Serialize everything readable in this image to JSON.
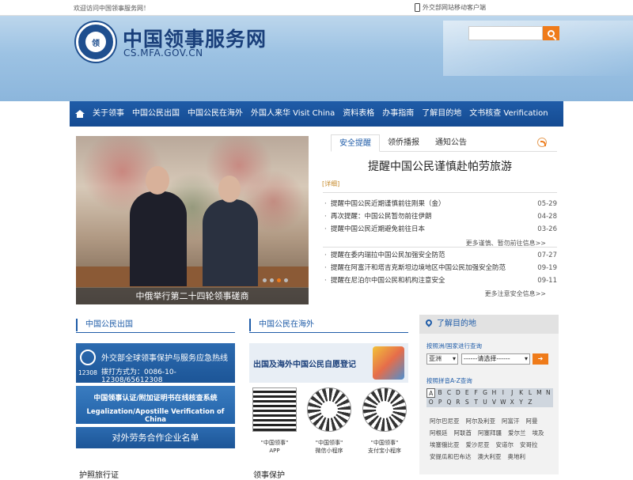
{
  "topbar": {
    "welcome": "欢迎访问中国领事服务网！",
    "mobile": "外交部网站移动客户端"
  },
  "site": {
    "title": "中国领事服务网",
    "domain": "CS.MFA.GOV.CN",
    "emblem_text": "领"
  },
  "nav": {
    "items": [
      "关于领事",
      "中国公民出国",
      "中国公民在海外",
      "外国人来华 Visit China",
      "资料表格",
      "办事指南",
      "了解目的地",
      "文书核查 Verification"
    ]
  },
  "hero": {
    "caption": "中俄举行第二十四轮领事磋商"
  },
  "tabs": {
    "items": [
      "安全提醒",
      "领侨播报",
      "通知公告"
    ],
    "active": 0
  },
  "headline": {
    "title": "提醒中国公民谨慎赴帕劳旅游",
    "detail": "[详细]"
  },
  "news1": [
    {
      "title": "提醒中国公民近期谨慎前往刚果（金）",
      "date": "05-29"
    },
    {
      "title": "再次提醒：中国公民暂勿前往伊朗",
      "date": "04-28"
    },
    {
      "title": "提醒中国公民近期避免前往日本",
      "date": "03-26"
    }
  ],
  "more1": "更多谨慎、暂勿前往信息>>",
  "news2": [
    {
      "title": "提醒在委内瑞拉中国公民加强安全防范",
      "date": "07-27"
    },
    {
      "title": "提醒在阿富汗和塔吉克斯坦边境地区中国公民加强安全防范",
      "date": "09-19"
    },
    {
      "title": "提醒在尼泊尔中国公民和机构注意安全",
      "date": "09-11"
    }
  ],
  "more2": "更多注意安全信息>>",
  "sections": {
    "outbound": "中国公民出国",
    "overseas": "中国公民在海外"
  },
  "hotline": {
    "title": "外交部全球领事保护与服务应急热线",
    "numbers": "拨打方式为：0086-10-12308/65612308",
    "badge": "12308"
  },
  "verify": {
    "cn": "中国领事认证/附加证明书在线核查系统",
    "en": "Legalization/Apostille Verification of China"
  },
  "labor": "对外劳务合作企业名单",
  "selfreg": "出国及海外中国公民自愿登记",
  "qrs": [
    {
      "label1": "\"中国领事\"",
      "label2": "APP"
    },
    {
      "label1": "\"中国领事\"",
      "label2": "微信小程序"
    },
    {
      "label1": "\"中国领事\"",
      "label2": "支付宝小程序"
    }
  ],
  "dest": {
    "title": "了解目的地",
    "by_continent": "按照洲/国家进行查询",
    "continent": "亚洲",
    "country": "------请选择------",
    "by_letter": "按照拼音A-Z查询",
    "letters": [
      "A",
      "B",
      "C",
      "D",
      "E",
      "F",
      "G",
      "H",
      "I",
      "J",
      "K",
      "L",
      "M",
      "N",
      "O",
      "P",
      "Q",
      "R",
      "S",
      "T",
      "U",
      "V",
      "W",
      "X",
      "Y",
      "Z"
    ],
    "countries": [
      "阿尔巴尼亚",
      "阿尔及利亚",
      "阿富汗",
      "阿曼",
      "阿根廷",
      "阿联酋",
      "阿塞拜疆",
      "爱尔兰",
      "埃及",
      "埃塞俄比亚",
      "爱沙尼亚",
      "安道尔",
      "安哥拉",
      "安提瓜和巴布达",
      "澳大利亚",
      "奥地利"
    ]
  },
  "bottom": {
    "left": "护照旅行证",
    "mid": "领事保护"
  }
}
